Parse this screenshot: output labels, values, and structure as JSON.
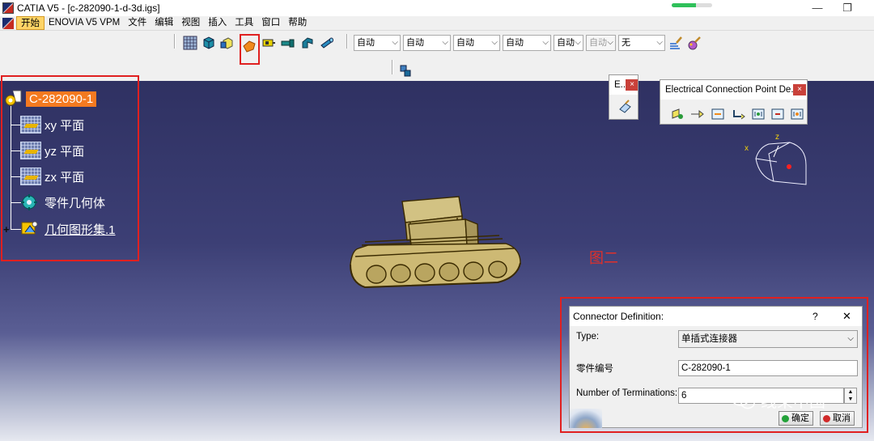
{
  "window": {
    "title": "CATIA V5 - [c-282090-1-d-3d.igs]",
    "maximize_glyph": "—",
    "restore_glyph": "❐",
    "progress_fraction": 0.6
  },
  "menu": {
    "items": [
      "开始",
      "ENOVIA V5 VPM",
      "文件",
      "编辑",
      "视图",
      "插入",
      "工具",
      "窗口",
      "帮助"
    ]
  },
  "toolbar": {
    "combos": [
      "自动",
      "自动",
      "自动",
      "自动",
      "自动",
      "自动",
      "无"
    ],
    "icons": [
      "grid-icon",
      "cube-icon",
      "part-icon",
      "connector-icon",
      "cavity-icon",
      "plug-icon",
      "bundle-icon",
      "pipe-icon",
      "brush-icon",
      "paint-icon",
      "snap-icon"
    ]
  },
  "tree": {
    "root": "C-282090-1",
    "nodes": [
      "xy 平面",
      "yz 平面",
      "zx 平面",
      "零件几何体",
      "几何图形集.1"
    ]
  },
  "small_toolbar": {
    "title": "E...",
    "close": "×"
  },
  "electrical_toolbar": {
    "title": "Electrical Connection Point De...",
    "close": "×"
  },
  "compass": {
    "x_label": "x",
    "z_label": "z"
  },
  "figure_label": "图二",
  "dialog": {
    "title": "Connector Definition:",
    "help": "?",
    "close": "✕",
    "type_label": "Type:",
    "type_value": "单插式连接器",
    "part_number_label": "零件编号",
    "part_number_value": "C-282090-1",
    "terminations_label": "Number of Terminations:",
    "terminations_value": "6",
    "ok_label": "确定",
    "cancel_label": "取消"
  },
  "watermark": {
    "text": "线束中国"
  },
  "colors": {
    "accent_orange": "#f47a20",
    "highlight_red": "#e02020",
    "viewport_top": "#2f3162",
    "model_fill": "#c9b778"
  }
}
